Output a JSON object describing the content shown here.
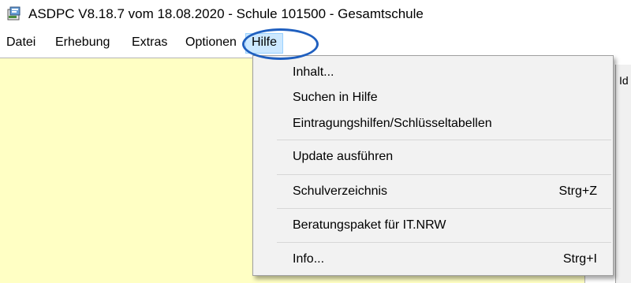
{
  "window": {
    "title": "ASDPC V8.18.7 vom 18.08.2020 - Schule 101500 - Gesamtschule",
    "icon": "app-icon"
  },
  "menubar": {
    "items": [
      {
        "label": "Datei"
      },
      {
        "label": "Erhebung"
      },
      {
        "label": "Extras"
      },
      {
        "label": "Optionen"
      },
      {
        "label": "Hilfe",
        "active": true
      }
    ]
  },
  "help_menu": {
    "items": [
      {
        "label": "Inhalt...",
        "shortcut": ""
      },
      {
        "label": "Suchen in Hilfe",
        "shortcut": ""
      },
      {
        "label": "Eintragungshilfen/Schlüsseltabellen",
        "shortcut": ""
      },
      {
        "label": "Update ausführen",
        "shortcut": ""
      },
      {
        "label": "Schulverzeichnis",
        "shortcut": "Strg+Z"
      },
      {
        "label": "Beratungspaket für IT.NRW",
        "shortcut": ""
      },
      {
        "label": "Info...",
        "shortcut": "Strg+I"
      }
    ]
  },
  "side_pane": {
    "glyph": "Id"
  },
  "colors": {
    "content_background": "#ffffc4",
    "menu_background": "#f2f2f2",
    "active_menu_highlight": "#cce8ff",
    "annotation_ring": "#1f5fbf"
  }
}
